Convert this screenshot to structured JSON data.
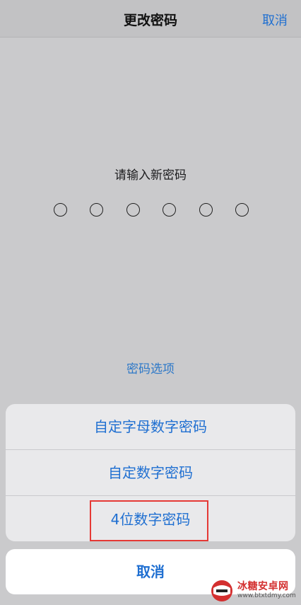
{
  "nav": {
    "title": "更改密码",
    "cancel_label": "取消"
  },
  "main": {
    "prompt": "请输入新密码",
    "passcode_length": 6,
    "options_link": "密码选项"
  },
  "action_sheet": {
    "items": [
      {
        "label": "自定字母数字密码"
      },
      {
        "label": "自定数字密码"
      },
      {
        "label": "4位数字密码"
      }
    ],
    "cancel_label": "取消"
  },
  "watermark": {
    "name": "冰糖安卓网",
    "url": "www.btxtdmy.com"
  },
  "colors": {
    "accent": "#1f6fd1",
    "highlight": "#e53935"
  }
}
